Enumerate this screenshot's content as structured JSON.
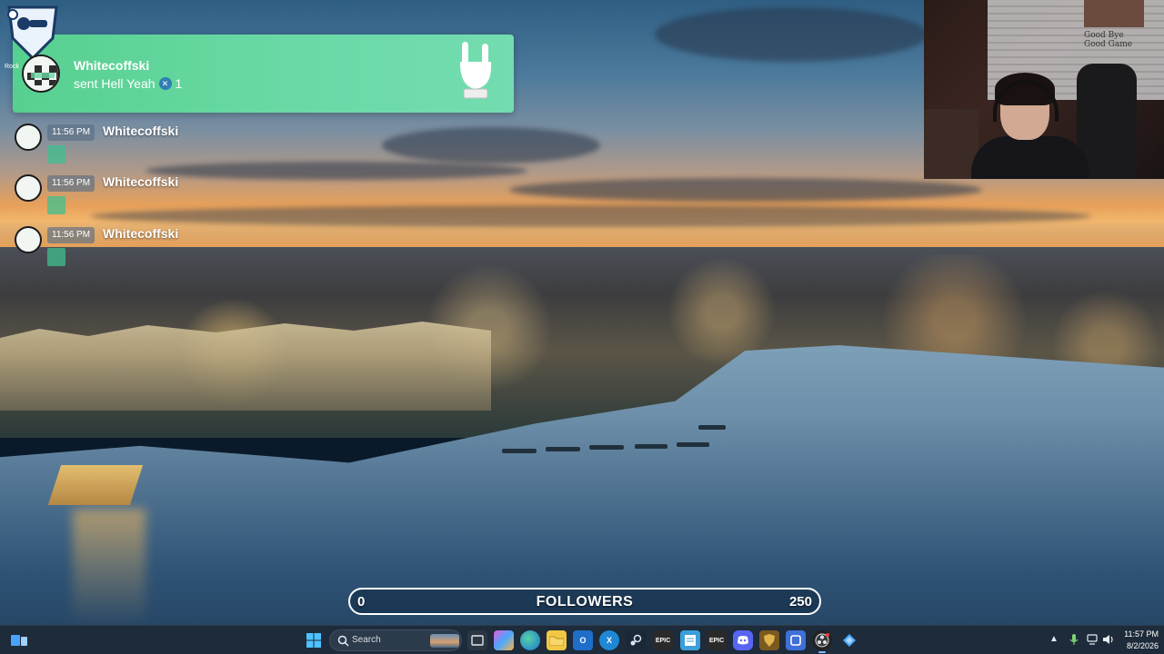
{
  "overlay": {
    "alert": {
      "username": "Whitecoffski",
      "message": "sent Hell Yeah",
      "gem_count": "1"
    },
    "rl_logo_label": "Rock",
    "chat": [
      {
        "time": "11:56 PM",
        "username": "Whitecoffski"
      },
      {
        "time": "11:56 PM",
        "username": "Whitecoffski"
      },
      {
        "time": "11:56 PM",
        "username": "Whitecoffski"
      }
    ]
  },
  "webcam": {
    "poster_text": "Good Bye\nGood Game"
  },
  "goal": {
    "title": "FOLLOWERS",
    "min": "0",
    "max": "250",
    "progress_fraction": 0.0
  },
  "taskbar": {
    "search_placeholder": "Search",
    "pinned_icons": [
      "windows-start",
      "search",
      "file-explorer",
      "copilot",
      "edge",
      "files",
      "outlook",
      "xbox",
      "steam",
      "epic-games",
      "notepad",
      "epic-games-2",
      "discord",
      "shield",
      "app",
      "obs-studio",
      "sapphire"
    ],
    "clock_time": "11:57 PM",
    "clock_date": "8/2/2026"
  },
  "colors": {
    "alert_green": "#56d08f",
    "taskbar_bg": "#1d2b3a",
    "goal_border": "#ffffff"
  }
}
